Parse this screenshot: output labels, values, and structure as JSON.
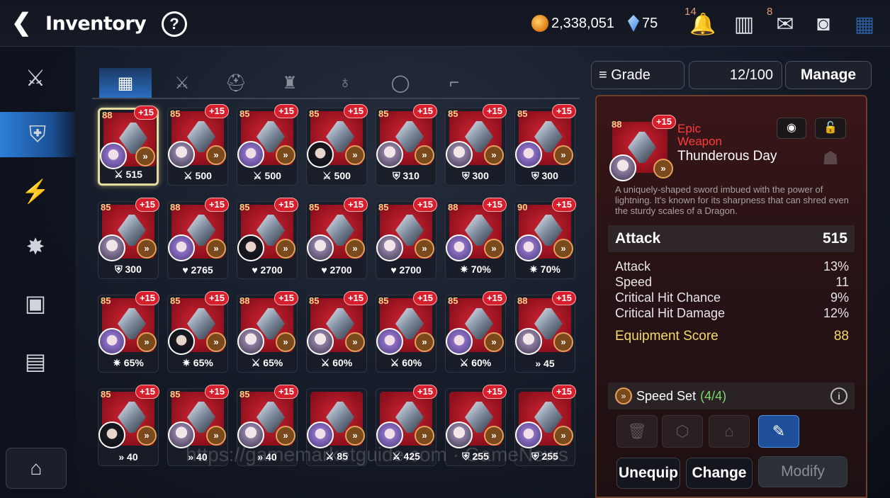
{
  "header": {
    "back_glyph": "❮",
    "title": "Inventory",
    "help_glyph": "?",
    "gold": "2,338,051",
    "crystals": "75",
    "bell_badge": "14",
    "mail_badge": "8"
  },
  "tabs": [
    {
      "icon": "grid-icon",
      "glyph": "▦"
    },
    {
      "icon": "sword-icon",
      "glyph": "⚔"
    },
    {
      "icon": "helmet-icon",
      "glyph": "⛑"
    },
    {
      "icon": "armor-icon",
      "glyph": "♜"
    },
    {
      "icon": "necklace-icon",
      "glyph": "♁"
    },
    {
      "icon": "ring-icon",
      "glyph": "◯"
    },
    {
      "icon": "boots-icon",
      "glyph": "⌐"
    }
  ],
  "grid": {
    "rows": [
      [
        {
          "lvl": "88",
          "plus": "+15",
          "stat": "⚔ 515"
        },
        {
          "lvl": "85",
          "plus": "+15",
          "stat": "⚔ 500"
        },
        {
          "lvl": "85",
          "plus": "+15",
          "stat": "⚔ 500"
        },
        {
          "lvl": "85",
          "plus": "+15",
          "stat": "⚔ 500"
        },
        {
          "lvl": "85",
          "plus": "+15",
          "stat": "⛨ 310"
        },
        {
          "lvl": "85",
          "plus": "+15",
          "stat": "⛨ 300"
        },
        {
          "lvl": "85",
          "plus": "+15",
          "stat": "⛨ 300"
        }
      ],
      [
        {
          "lvl": "85",
          "plus": "+15",
          "stat": "⛨ 300"
        },
        {
          "lvl": "88",
          "plus": "+15",
          "stat": "♥ 2765"
        },
        {
          "lvl": "85",
          "plus": "+15",
          "stat": "♥ 2700"
        },
        {
          "lvl": "85",
          "plus": "+15",
          "stat": "♥ 2700"
        },
        {
          "lvl": "85",
          "plus": "+15",
          "stat": "♥ 2700"
        },
        {
          "lvl": "88",
          "plus": "+15",
          "stat": "✷ 70%"
        },
        {
          "lvl": "90",
          "plus": "+15",
          "stat": "✷ 70%"
        }
      ],
      [
        {
          "lvl": "85",
          "plus": "+15",
          "stat": "✷ 65%"
        },
        {
          "lvl": "85",
          "plus": "+15",
          "stat": "✷ 65%"
        },
        {
          "lvl": "88",
          "plus": "+15",
          "stat": "⚔ 65%"
        },
        {
          "lvl": "85",
          "plus": "+15",
          "stat": "⚔ 60%"
        },
        {
          "lvl": "85",
          "plus": "+15",
          "stat": "⚔ 60%"
        },
        {
          "lvl": "85",
          "plus": "+15",
          "stat": "⚔ 60%"
        },
        {
          "lvl": "88",
          "plus": "+15",
          "stat": "» 45"
        }
      ],
      [
        {
          "lvl": "85",
          "plus": "+15",
          "stat": "» 40"
        },
        {
          "lvl": "85",
          "plus": "+15",
          "stat": "» 40"
        },
        {
          "lvl": "85",
          "plus": "+15",
          "stat": "» 40"
        },
        {
          "lvl": "",
          "plus": "",
          "stat": "⚔ 85"
        },
        {
          "lvl": "",
          "plus": "+15",
          "stat": "⚔ 425"
        },
        {
          "lvl": "",
          "plus": "+15",
          "stat": "⛨ 255"
        },
        {
          "lvl": "",
          "plus": "+15",
          "stat": "⛨ 255"
        }
      ]
    ]
  },
  "filter": {
    "grade": "Grade",
    "capacity": "12/100",
    "manage": "Manage"
  },
  "detail": {
    "level": "88",
    "plus": "+15",
    "rarity": "Epic",
    "type": "Weapon",
    "name": "Thunderous Day",
    "description": "A uniquely-shaped sword imbued with the power of lightning. It's known for its sharpness that can shred even the sturdy scales of a Dragon.",
    "main_label": "Attack",
    "main_value": "515",
    "substats": [
      {
        "label": "Attack",
        "value": "13%"
      },
      {
        "label": "Speed",
        "value": "11"
      },
      {
        "label": "Critical Hit Chance",
        "value": "9%"
      },
      {
        "label": "Critical Hit Damage",
        "value": "12%"
      }
    ],
    "score_label": "Equipment Score",
    "score_value": "88",
    "set_label": "Speed Set",
    "set_count": "(4/4)",
    "info_glyph": "i",
    "unequip": "Unequip",
    "change": "Change",
    "modify": "Modify"
  },
  "watermark": "https://gamemarketguide.com · GameNews",
  "colors": {
    "accent": "#2b6ec0",
    "rarity": "#ff3b3b",
    "score": "#f3d96a",
    "set_count": "#7cd96a"
  }
}
